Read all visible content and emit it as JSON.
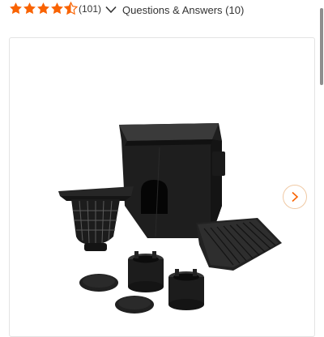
{
  "product": {
    "rating": 4.5,
    "review_count": "(101)",
    "qa_label": "Questions & Answers (10)",
    "image_alt": "Black plastic catch basin kit with square basin, filter basket, grate, and adapter fittings"
  },
  "icons": {
    "star": "star-icon",
    "chevron": "chevron-down-icon",
    "next": "chevron-right-icon"
  },
  "colors": {
    "star": "#f96302",
    "star_empty": "#e5e5e5",
    "text": "#333333",
    "accent": "#f96302",
    "button_border": "#f0c9a4",
    "product": "#1b1b1b"
  }
}
